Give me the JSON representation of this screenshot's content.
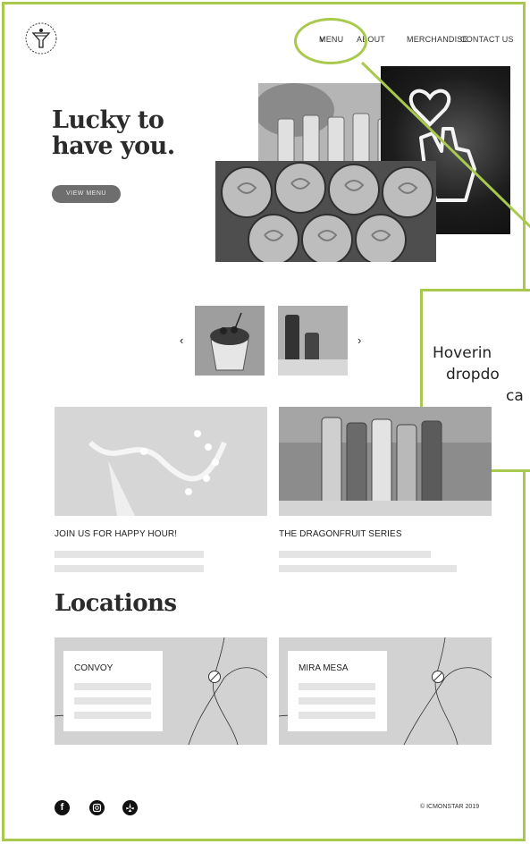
{
  "nav": {
    "items": [
      {
        "label": "MENU",
        "has_dropdown": true
      },
      {
        "label": "ABOUT"
      },
      {
        "label": "MERCHANDISE"
      },
      {
        "label": "CONTACT US"
      }
    ]
  },
  "hero": {
    "headline_line1": "Lucky to",
    "headline_line2": "have you.",
    "button_label": "VIEW MENU"
  },
  "annotation": {
    "line1": "Hoverin",
    "line2": "dropdo",
    "line3": "ca",
    "color": "#a9c94e"
  },
  "carousel": {
    "prev_glyph": "‹",
    "next_glyph": "›"
  },
  "cards": [
    {
      "title": "JOIN US FOR HAPPY HOUR!"
    },
    {
      "title": "THE DRAGONFRUIT SERIES"
    }
  ],
  "locations": {
    "title": "Locations",
    "items": [
      {
        "name": "CONVOY"
      },
      {
        "name": "MIRA MESA"
      }
    ]
  },
  "footer": {
    "social_icons": [
      "facebook-icon",
      "instagram-icon",
      "yelp-icon"
    ],
    "copyright": "© ICMONSTAR 2019"
  }
}
